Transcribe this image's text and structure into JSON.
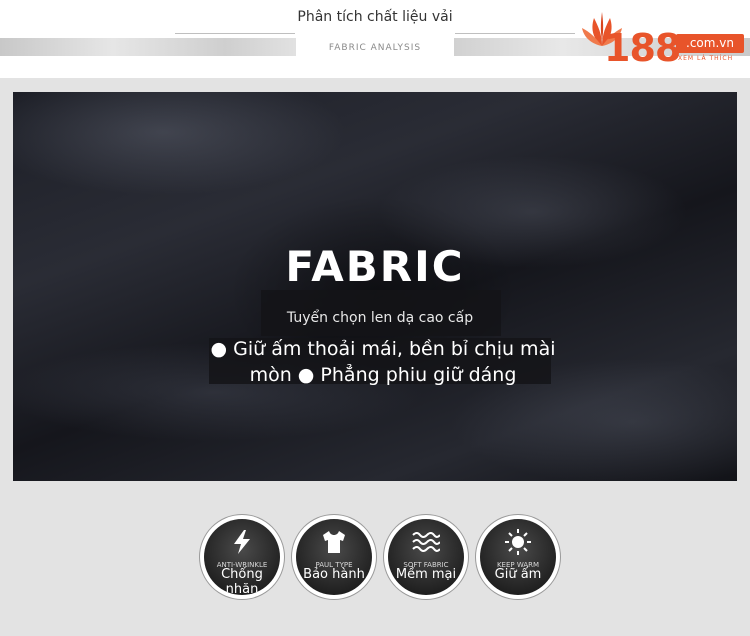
{
  "header": {
    "title": "Phân tích chất liệu vải",
    "subtitle": "FABRIC ANALYSIS"
  },
  "logo": {
    "number": "188",
    "domain": ".com.vn",
    "slogan": "XEM LÀ THÍCH",
    "colors": {
      "brand": "#e8542a"
    }
  },
  "hero": {
    "title": "FABRIC",
    "subtitle": "Tuyển chọn len dạ cao cấp",
    "features_line": "● Giữ ấm thoải mái, bền bỉ chịu mài mòn ● Phẳng phiu giữ dáng"
  },
  "features": [
    {
      "icon": "lightning-icon",
      "en": "ANTI-WRINKLE",
      "label": "Chống nhăn"
    },
    {
      "icon": "tshirt-icon",
      "en": "PAUL TYPE",
      "label": "Bảo hành"
    },
    {
      "icon": "waves-icon",
      "en": "SOFT FABRIC",
      "label": "Mềm mại"
    },
    {
      "icon": "sun-icon",
      "en": "KEEP WARM",
      "label": "Giữ ấm"
    }
  ]
}
